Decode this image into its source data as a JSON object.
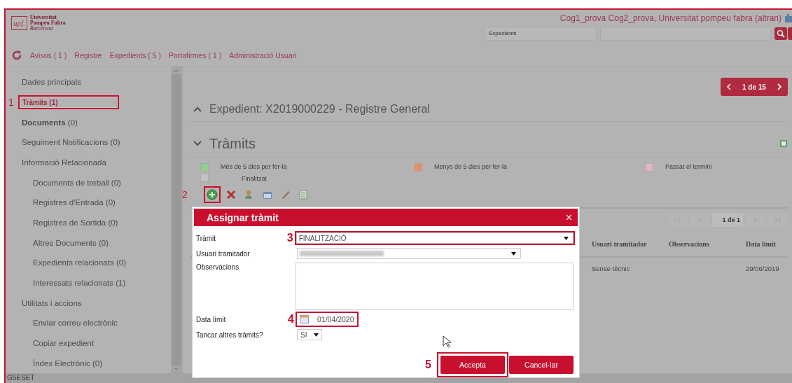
{
  "header": {
    "logo_mark": "upf.",
    "logo_lines": [
      "Universitat",
      "Pompeu Fabra",
      "Barcelona"
    ],
    "user": "Cog1_prova Cog2_prova, Universitat pompeu fabra (altran)",
    "search_scope": "Expedients"
  },
  "nav": [
    "Avisos ( 1 )",
    "Registre",
    "Expedients ( 5 )",
    "Portafirmes ( 1 )",
    "Administració Usuari"
  ],
  "sidebar": {
    "items": [
      {
        "label": "Dades principals",
        "selected": false
      },
      {
        "label": "Tràmits (1)",
        "selected": true,
        "callout": "1"
      },
      {
        "label": "**Documents** (0)",
        "selected": false
      },
      {
        "label": "Seguiment Notificacions (0)",
        "selected": false
      },
      {
        "label": "Informació Relacionada",
        "selected": false,
        "children": [
          {
            "label": "Documents de treball (0)",
            "selected": false
          },
          {
            "label": "Registres d'Entrada (0)",
            "selected": false
          },
          {
            "label": "Registres de Sortida (0)",
            "selected": false
          },
          {
            "label": "Altres Documents (0)",
            "selected": false
          },
          {
            "label": "Expedients relacionats (0)",
            "selected": false
          },
          {
            "label": "Interessats relacionats (1)",
            "selected": false
          }
        ]
      },
      {
        "label": "Utilitats i accions",
        "selected": false,
        "children": [
          {
            "label": "Enviar correu electrònic",
            "selected": false
          },
          {
            "label": "Copiar expedient",
            "selected": false
          },
          {
            "label": "Índex Electrònic (0)",
            "selected": false
          }
        ]
      }
    ]
  },
  "pager": "1 de 15",
  "expedient": {
    "title": "Expedient: X2019000229 - Registre General",
    "expanded": false
  },
  "tramits": {
    "title": "Tràmits",
    "expanded": true,
    "legend": [
      {
        "label": "Més de 5 dies per fer-la",
        "color": "#8fd08f"
      },
      {
        "label": "Menys de 5 dies per fer-la",
        "color": "#e0906a"
      },
      {
        "label": "Passat el termini",
        "color": "#e2b6bd"
      },
      {
        "label": "Finalitzat",
        "color": "#c2c2c2"
      }
    ],
    "toolbar_callout": "2",
    "table": {
      "pager": "1 de 1",
      "columns": [
        "Usuari tramitador",
        "Observacions",
        "Data límit"
      ],
      "rows": [
        {
          "usuari": "Sense tècnic",
          "data_limit": "29/06/2019"
        }
      ]
    }
  },
  "dialog": {
    "title": "Assignar tràmit",
    "close": "×",
    "fields": [
      {
        "kind": "select",
        "label": "Tràmit",
        "value": "FINALITZACIÓ",
        "callout": "3"
      },
      {
        "kind": "select",
        "label": "Usuari tramitador",
        "redacted": true
      },
      {
        "kind": "textarea",
        "label": "Observacions"
      },
      {
        "kind": "date",
        "label": "Data límit",
        "value": "01/04/2020",
        "callout": "4"
      },
      {
        "kind": "small-select",
        "label": "Tancar altres tràmits?",
        "value": "SI"
      }
    ],
    "buttons": [
      {
        "label": "Accepta",
        "callout": "5"
      },
      {
        "label": "Cancel·lar"
      }
    ]
  },
  "status_bar": "G5ESET"
}
